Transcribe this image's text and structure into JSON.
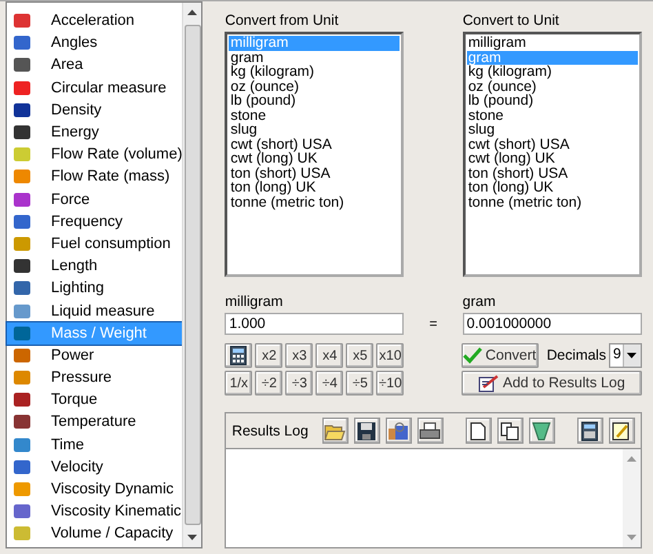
{
  "categories": [
    {
      "label": "Acceleration",
      "selected": false
    },
    {
      "label": "Angles",
      "selected": false
    },
    {
      "label": "Area",
      "selected": false
    },
    {
      "label": "Circular measure",
      "selected": false
    },
    {
      "label": "Density",
      "selected": false
    },
    {
      "label": "Energy",
      "selected": false
    },
    {
      "label": "Flow Rate (volume)",
      "selected": false
    },
    {
      "label": "Flow Rate (mass)",
      "selected": false
    },
    {
      "label": "Force",
      "selected": false
    },
    {
      "label": "Frequency",
      "selected": false
    },
    {
      "label": "Fuel consumption",
      "selected": false
    },
    {
      "label": "Length",
      "selected": false
    },
    {
      "label": "Lighting",
      "selected": false
    },
    {
      "label": "Liquid measure",
      "selected": false
    },
    {
      "label": "Mass / Weight",
      "selected": true
    },
    {
      "label": "Power",
      "selected": false
    },
    {
      "label": "Pressure",
      "selected": false
    },
    {
      "label": "Torque",
      "selected": false
    },
    {
      "label": "Temperature",
      "selected": false
    },
    {
      "label": "Time",
      "selected": false
    },
    {
      "label": "Velocity",
      "selected": false
    },
    {
      "label": "Viscosity Dynamic",
      "selected": false
    },
    {
      "label": "Viscosity Kinematic",
      "selected": false
    },
    {
      "label": "Volume / Capacity",
      "selected": false
    }
  ],
  "from_unit": {
    "label": "Convert from Unit",
    "units": [
      {
        "label": "milligram",
        "selected": true
      },
      {
        "label": "gram",
        "selected": false
      },
      {
        "label": "kg (kilogram)",
        "selected": false
      },
      {
        "label": "oz (ounce)",
        "selected": false
      },
      {
        "label": "lb (pound)",
        "selected": false
      },
      {
        "label": "stone",
        "selected": false
      },
      {
        "label": "slug",
        "selected": false
      },
      {
        "label": "cwt (short) USA",
        "selected": false
      },
      {
        "label": "cwt (long) UK",
        "selected": false
      },
      {
        "label": "ton (short) USA",
        "selected": false
      },
      {
        "label": "ton (long) UK",
        "selected": false
      },
      {
        "label": "tonne (metric ton)",
        "selected": false
      }
    ]
  },
  "to_unit": {
    "label": "Convert to Unit",
    "units": [
      {
        "label": "milligram",
        "selected": false
      },
      {
        "label": "gram",
        "selected": true
      },
      {
        "label": "kg (kilogram)",
        "selected": false
      },
      {
        "label": "oz (ounce)",
        "selected": false
      },
      {
        "label": "lb (pound)",
        "selected": false
      },
      {
        "label": "stone",
        "selected": false
      },
      {
        "label": "slug",
        "selected": false
      },
      {
        "label": "cwt (short) USA",
        "selected": false
      },
      {
        "label": "cwt (long) UK",
        "selected": false
      },
      {
        "label": "ton (short) USA",
        "selected": false
      },
      {
        "label": "ton (long) UK",
        "selected": false
      },
      {
        "label": "tonne (metric ton)",
        "selected": false
      }
    ]
  },
  "from_value": {
    "label": "milligram",
    "value": "1.000"
  },
  "equals": "=",
  "to_value": {
    "label": "gram",
    "value": "0.001000000"
  },
  "multiply_buttons": [
    "x2",
    "x3",
    "x4",
    "x5",
    "x10"
  ],
  "divide_buttons": [
    "1/x",
    "÷2",
    "÷3",
    "÷4",
    "÷5",
    "÷10"
  ],
  "convert_button": "Convert",
  "decimals": {
    "label": "Decimals",
    "value": "9"
  },
  "add_button": "Add to Results Log",
  "results_log": {
    "label": "Results Log"
  }
}
